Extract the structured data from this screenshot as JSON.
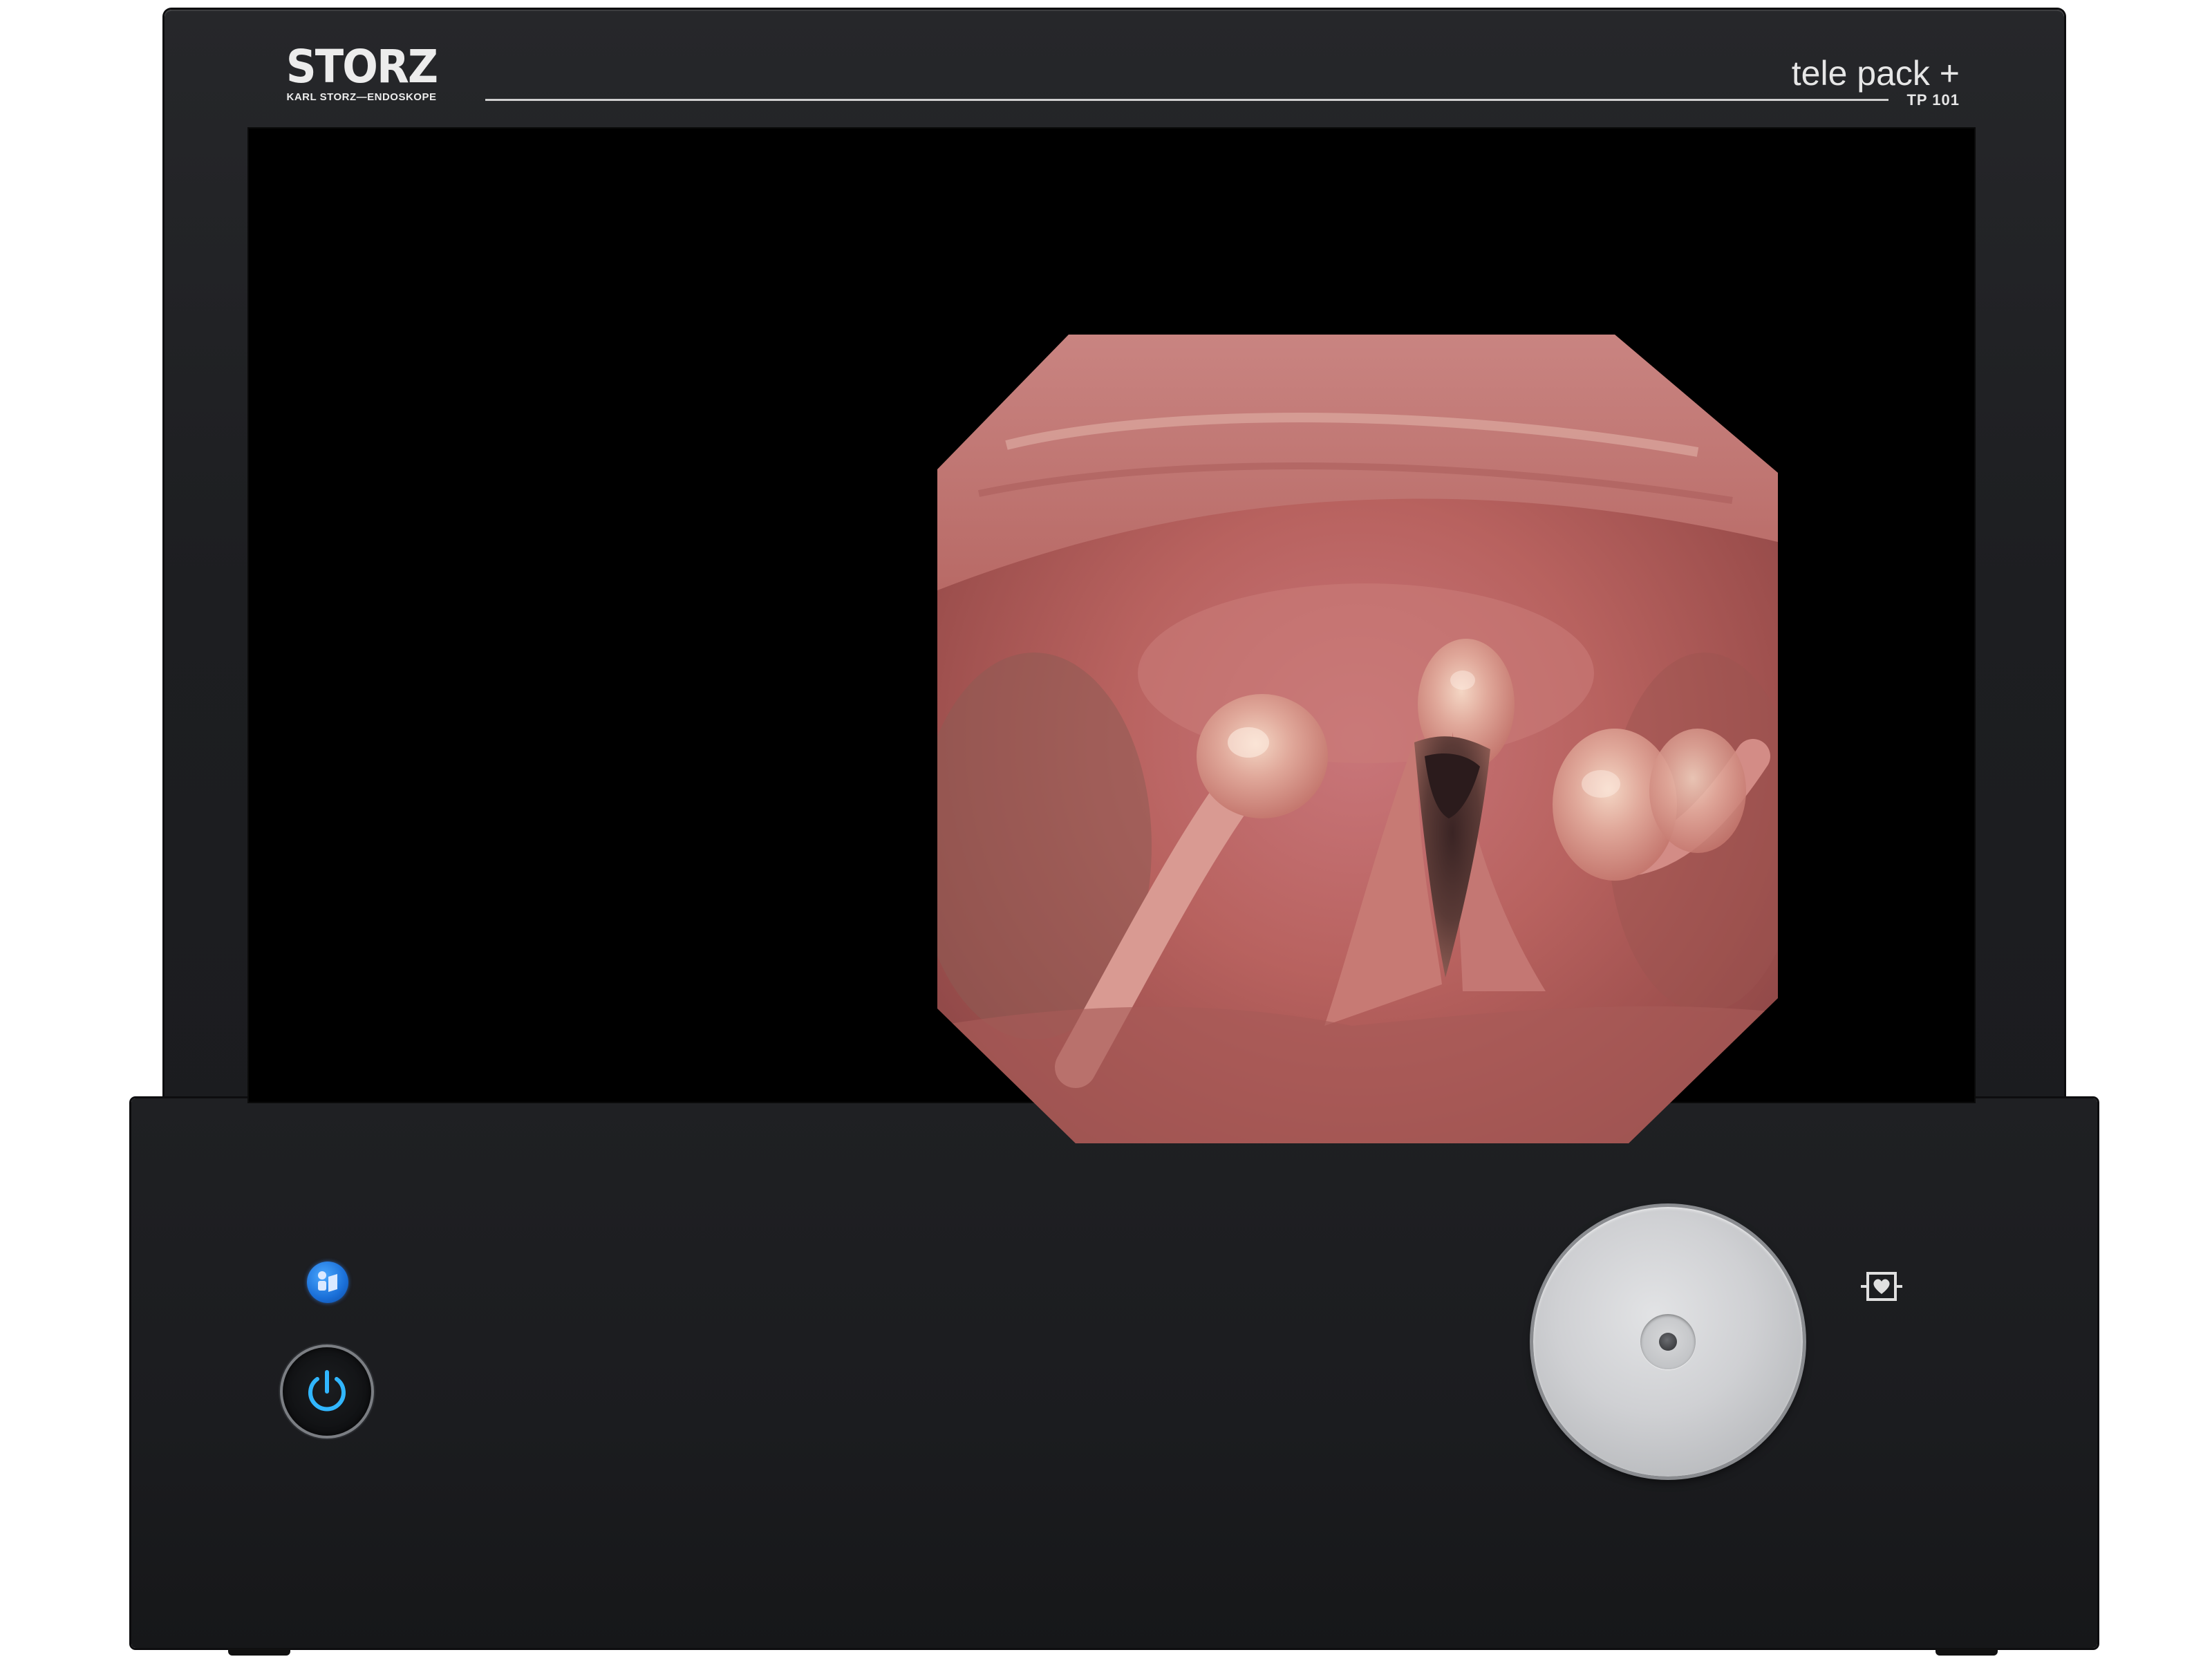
{
  "device": {
    "brand": "STORZ",
    "brand_subtitle": "KARL STORZ—ENDOSKOPE",
    "model_name": "tele pack +",
    "model_code": "TP 101"
  },
  "display": {
    "content": "endoscopic-larynx-view"
  },
  "controls": {
    "status_indicator_icon": "operator-manual-icon",
    "power_icon": "power-icon",
    "knob_icon": "rotary-knob",
    "defib_icon": "defibrillation-proof-icon"
  },
  "colors": {
    "housing": "#1d1e21",
    "screen": "#000000",
    "power_glow": "#31b6ff",
    "indicator_blue": "#1a6fd8",
    "knob_silver": "#cfd0d3"
  }
}
